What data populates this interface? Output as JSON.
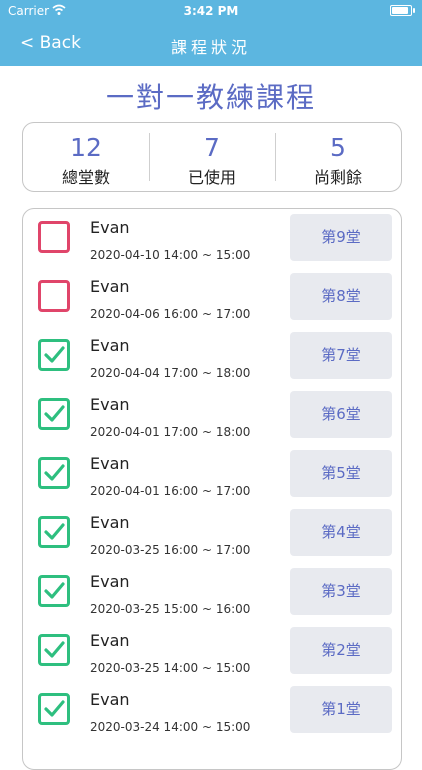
{
  "status_bar": {
    "carrier": "Carrier",
    "time": "3:42 PM"
  },
  "nav": {
    "back_label": "< Back",
    "title": "課程狀況"
  },
  "page_title": "一對一教練課程",
  "summary": [
    {
      "value": "12",
      "label": "總堂數"
    },
    {
      "value": "7",
      "label": "已使用"
    },
    {
      "value": "5",
      "label": "尚剩餘"
    }
  ],
  "colors": {
    "header": "#5cb6e0",
    "accent": "#5b6bc4",
    "checked": "#2ebf7f",
    "unchecked": "#e0456a"
  },
  "sessions": [
    {
      "name": "Evan",
      "time": "2020-04-10 14:00 ~ 15:00",
      "label": "第9堂",
      "checked": false
    },
    {
      "name": "Evan",
      "time": "2020-04-06 16:00 ~ 17:00",
      "label": "第8堂",
      "checked": false
    },
    {
      "name": "Evan",
      "time": "2020-04-04 17:00 ~ 18:00",
      "label": "第7堂",
      "checked": true
    },
    {
      "name": "Evan",
      "time": "2020-04-01 17:00 ~ 18:00",
      "label": "第6堂",
      "checked": true
    },
    {
      "name": "Evan",
      "time": "2020-04-01 16:00 ~ 17:00",
      "label": "第5堂",
      "checked": true
    },
    {
      "name": "Evan",
      "time": "2020-03-25 16:00 ~ 17:00",
      "label": "第4堂",
      "checked": true
    },
    {
      "name": "Evan",
      "time": "2020-03-25 15:00 ~ 16:00",
      "label": "第3堂",
      "checked": true
    },
    {
      "name": "Evan",
      "time": "2020-03-25 14:00 ~ 15:00",
      "label": "第2堂",
      "checked": true
    },
    {
      "name": "Evan",
      "time": "2020-03-24 14:00 ~ 15:00",
      "label": "第1堂",
      "checked": true
    }
  ]
}
